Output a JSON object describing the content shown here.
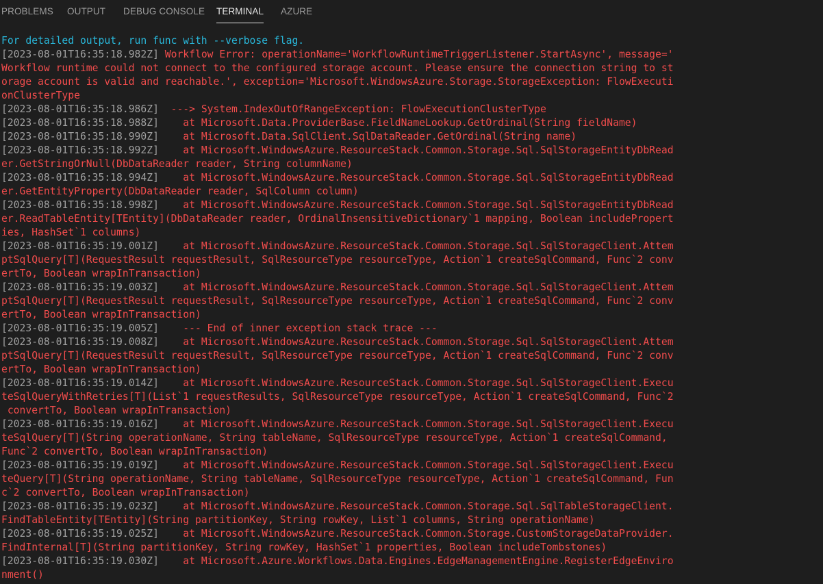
{
  "tabs": [
    {
      "label": "PROBLEMS",
      "active": false
    },
    {
      "label": "OUTPUT",
      "active": false
    },
    {
      "label": "DEBUG CONSOLE",
      "active": false
    },
    {
      "label": "TERMINAL",
      "active": true
    },
    {
      "label": "AZURE",
      "active": false
    }
  ],
  "terminal": {
    "lines": [
      {
        "text": "For detailed output, run func with --verbose flag."
      },
      {
        "ts": "[2023-08-01T16:35:18.982Z]",
        "text": " Workflow Error: operationName='WorkflowRuntimeTriggerListener.StartAsync', message='"
      },
      {
        "text": "Workflow runtime could not connect to the configured storage account. Please ensure the connection string to st"
      },
      {
        "text": "orage account is valid and reachable.', exception='Microsoft.WindowsAzure.Storage.StorageException: FlowExecuti"
      },
      {
        "text": "onClusterType"
      },
      {
        "ts": "[2023-08-01T16:35:18.986Z]",
        "text": "  ---> System.IndexOutOfRangeException: FlowExecutionClusterType"
      },
      {
        "ts": "[2023-08-01T16:35:18.988Z]",
        "text": "    at Microsoft.Data.ProviderBase.FieldNameLookup.GetOrdinal(String fieldName)"
      },
      {
        "ts": "[2023-08-01T16:35:18.990Z]",
        "text": "    at Microsoft.Data.SqlClient.SqlDataReader.GetOrdinal(String name)"
      },
      {
        "ts": "[2023-08-01T16:35:18.992Z]",
        "text": "    at Microsoft.WindowsAzure.ResourceStack.Common.Storage.Sql.SqlStorageEntityDbRead"
      },
      {
        "text": "er.GetStringOrNull(DbDataReader reader, String columnName)"
      },
      {
        "ts": "[2023-08-01T16:35:18.994Z]",
        "text": "    at Microsoft.WindowsAzure.ResourceStack.Common.Storage.Sql.SqlStorageEntityDbRead"
      },
      {
        "text": "er.GetEntityProperty(DbDataReader reader, SqlColumn column)"
      },
      {
        "ts": "[2023-08-01T16:35:18.998Z]",
        "text": "    at Microsoft.WindowsAzure.ResourceStack.Common.Storage.Sql.SqlStorageEntityDbRead"
      },
      {
        "text": "er.ReadTableEntity[TEntity](DbDataReader reader, OrdinalInsensitiveDictionary`1 mapping, Boolean includePropert"
      },
      {
        "text": "ies, HashSet`1 columns)"
      },
      {
        "ts": "[2023-08-01T16:35:19.001Z]",
        "text": "    at Microsoft.WindowsAzure.ResourceStack.Common.Storage.Sql.SqlStorageClient.Attem"
      },
      {
        "text": "ptSqlQuery[T](RequestResult requestResult, SqlResourceType resourceType, Action`1 createSqlCommand, Func`2 conv"
      },
      {
        "text": "ertTo, Boolean wrapInTransaction)"
      },
      {
        "ts": "[2023-08-01T16:35:19.003Z]",
        "text": "    at Microsoft.WindowsAzure.ResourceStack.Common.Storage.Sql.SqlStorageClient.Attem"
      },
      {
        "text": "ptSqlQuery[T](RequestResult requestResult, SqlResourceType resourceType, Action`1 createSqlCommand, Func`2 conv"
      },
      {
        "text": "ertTo, Boolean wrapInTransaction)"
      },
      {
        "ts": "[2023-08-01T16:35:19.005Z]",
        "text": "    --- End of inner exception stack trace ---"
      },
      {
        "ts": "[2023-08-01T16:35:19.008Z]",
        "text": "    at Microsoft.WindowsAzure.ResourceStack.Common.Storage.Sql.SqlStorageClient.Attem"
      },
      {
        "text": "ptSqlQuery[T](RequestResult requestResult, SqlResourceType resourceType, Action`1 createSqlCommand, Func`2 conv"
      },
      {
        "text": "ertTo, Boolean wrapInTransaction)"
      },
      {
        "ts": "[2023-08-01T16:35:19.014Z]",
        "text": "    at Microsoft.WindowsAzure.ResourceStack.Common.Storage.Sql.SqlStorageClient.Execu"
      },
      {
        "text": "teSqlQueryWithRetries[T](List`1 requestResults, SqlResourceType resourceType, Action`1 createSqlCommand, Func`2"
      },
      {
        "text": " convertTo, Boolean wrapInTransaction)"
      },
      {
        "ts": "[2023-08-01T16:35:19.016Z]",
        "text": "    at Microsoft.WindowsAzure.ResourceStack.Common.Storage.Sql.SqlStorageClient.Execu"
      },
      {
        "text": "teSqlQuery[T](String operationName, String tableName, SqlResourceType resourceType, Action`1 createSqlCommand,"
      },
      {
        "text": "Func`2 convertTo, Boolean wrapInTransaction)"
      },
      {
        "ts": "[2023-08-01T16:35:19.019Z]",
        "text": "    at Microsoft.WindowsAzure.ResourceStack.Common.Storage.Sql.SqlStorageClient.Execu"
      },
      {
        "text": "teQuery[T](String operationName, String tableName, SqlResourceType resourceType, Action`1 createSqlCommand, Fun"
      },
      {
        "text": "c`2 convertTo, Boolean wrapInTransaction)"
      },
      {
        "ts": "[2023-08-01T16:35:19.023Z]",
        "text": "    at Microsoft.WindowsAzure.ResourceStack.Common.Storage.Sql.SqlTableStorageClient."
      },
      {
        "text": "FindTableEntity[TEntity](String partitionKey, String rowKey, List`1 columns, String operationName)"
      },
      {
        "ts": "[2023-08-01T16:35:19.025Z]",
        "text": "    at Microsoft.WindowsAzure.ResourceStack.Common.Storage.CustomStorageDataProvider."
      },
      {
        "text": "FindInternal[T](String partitionKey, String rowKey, HashSet`1 properties, Boolean includeTombstones)"
      },
      {
        "ts": "[2023-08-01T16:35:19.030Z]",
        "text": "    at Microsoft.Azure.Workflows.Data.Engines.EdgeManagementEngine.RegisterEdgeEnviro"
      },
      {
        "text": "nment()"
      }
    ]
  },
  "colors": {
    "background": "#1e1e1e",
    "tab_inactive": "#9d9d9d",
    "tab_active": "#e7e7e7",
    "info_text": "#29b8db",
    "timestamp": "#a0a0a0",
    "error_text": "#f14c4c"
  }
}
